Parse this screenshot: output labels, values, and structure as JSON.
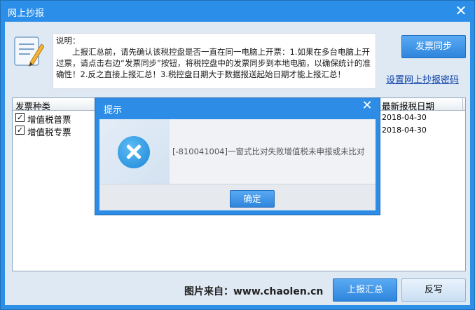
{
  "window": {
    "title": "网上抄报"
  },
  "instructions": {
    "heading": "说明：",
    "body": "上报汇总前，请先确认该税控盘是否一直在同一电脑上开票：1.如果在多台电脑上开过票，请点击右边“发票同步”按钮，将税控盘中的发票同步到本地电脑，以确保统计的准确性！2.反之直接上报汇总！3.税控盘日期大于数据报送起始日期才能上报汇总！"
  },
  "actions": {
    "sync_label": "发票同步",
    "set_password_link": "设置网上抄报密码"
  },
  "table": {
    "columns": {
      "type": "发票种类",
      "latest_date": "最新报税日期"
    },
    "rows": [
      {
        "checked": true,
        "name": "增值税普票",
        "latest_date": "2018-04-30"
      },
      {
        "checked": true,
        "name": "增值税专票",
        "latest_date": "2018-04-30"
      }
    ]
  },
  "footer": {
    "watermark": "图片来自：www.chaolen.cn",
    "submit_label": "上报汇总",
    "writeback_label": "反写"
  },
  "dialog": {
    "title": "提示",
    "message": "[-810041004]一窗式比对失败增值税未申报或未比对",
    "ok_label": "确定",
    "icon": "error-icon"
  },
  "colors": {
    "accent": "#2d8de6",
    "link": "#0b3fa8",
    "client_bg": "#dfe9f3"
  }
}
